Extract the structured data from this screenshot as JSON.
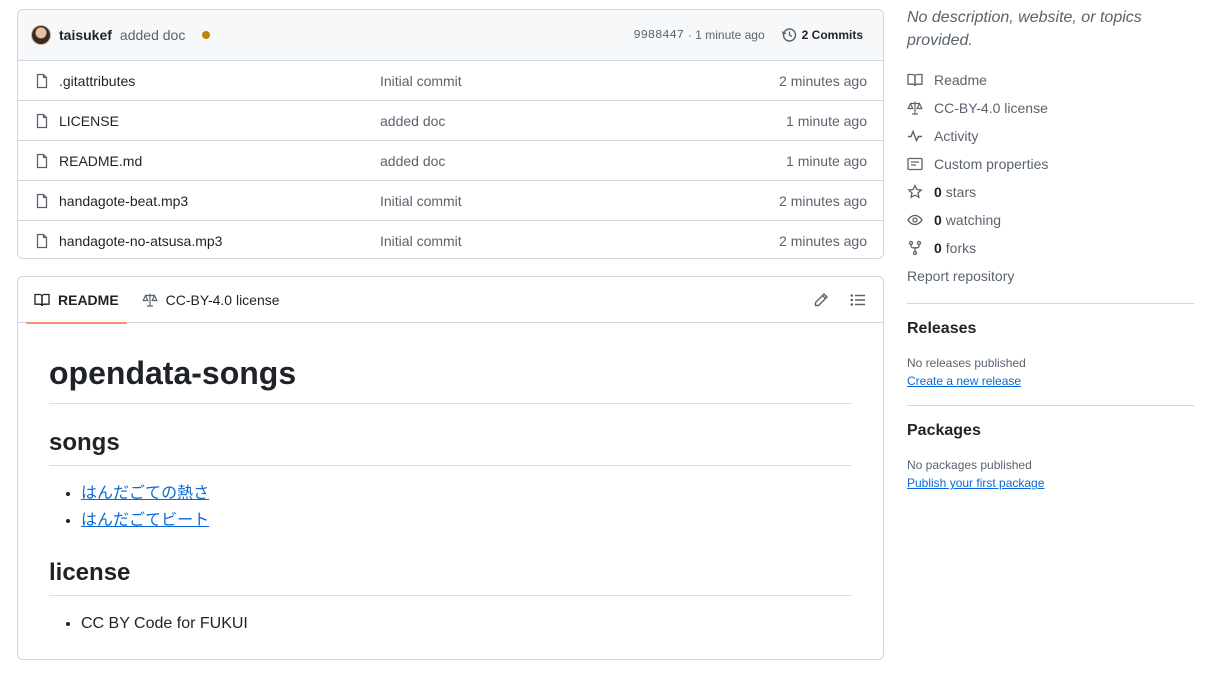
{
  "latest_commit": {
    "author": "taisukef",
    "message": "added doc",
    "sha": "9988447",
    "time": "· 1 minute ago",
    "commits_label": "2 Commits",
    "status_color": "#bf8700"
  },
  "files": [
    {
      "name": ".gitattributes",
      "commit": "Initial commit",
      "time": "2 minutes ago"
    },
    {
      "name": "LICENSE",
      "commit": "added doc",
      "time": "1 minute ago"
    },
    {
      "name": "README.md",
      "commit": "added doc",
      "time": "1 minute ago"
    },
    {
      "name": "handagote-beat.mp3",
      "commit": "Initial commit",
      "time": "2 minutes ago"
    },
    {
      "name": "handagote-no-atsusa.mp3",
      "commit": "Initial commit",
      "time": "2 minutes ago"
    }
  ],
  "readme_tabs": {
    "readme": "README",
    "license": "CC-BY-4.0 license"
  },
  "readme": {
    "title": "opendata-songs",
    "songs_heading": "songs",
    "songs": [
      "はんだごての熱さ",
      "はんだごてビート"
    ],
    "license_heading": "license",
    "license_items": [
      "CC BY Code for FUKUI"
    ]
  },
  "sidebar": {
    "description": "No description, website, or topics provided.",
    "readme": "Readme",
    "license": "CC-BY-4.0 license",
    "activity": "Activity",
    "custom_properties": "Custom properties",
    "stars_count": "0",
    "stars_label": "stars",
    "watching_count": "0",
    "watching_label": "watching",
    "forks_count": "0",
    "forks_label": "forks",
    "report": "Report repository",
    "releases_heading": "Releases",
    "releases_text": "No releases published",
    "releases_link": "Create a new release",
    "packages_heading": "Packages",
    "packages_text": "No packages published",
    "packages_link": "Publish your first package"
  },
  "accent_colors": {
    "link": "#0969da",
    "tab_underline": "#fd8c73",
    "muted": "#59636e"
  }
}
